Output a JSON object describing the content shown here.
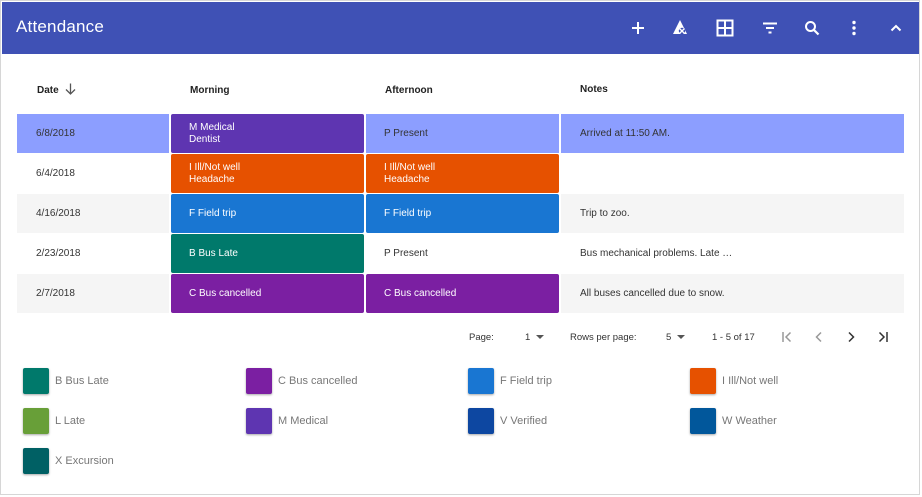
{
  "appbar": {
    "title": "Attendance",
    "background": "#3f51b5",
    "actions": [
      {
        "name": "add-icon"
      },
      {
        "name": "clear-formatting-icon"
      },
      {
        "name": "table-view-icon"
      },
      {
        "name": "filter-icon"
      },
      {
        "name": "search-icon"
      },
      {
        "name": "more-vert-icon"
      },
      {
        "name": "collapse-icon"
      }
    ]
  },
  "table": {
    "headers": {
      "date": "Date",
      "morning": "Morning",
      "afternoon": "Afternoon",
      "notes": "Notes"
    },
    "sort_direction": "descending",
    "rows": [
      {
        "date": "6/8/2018",
        "morning": {
          "line1": "M Medical",
          "line2": "Dentist",
          "color": "#5e35b1"
        },
        "afternoon": {
          "line1": "P Present",
          "line2": "",
          "color": ""
        },
        "notes": "Arrived at 11:50 AM.",
        "selected": true
      },
      {
        "date": "6/4/2018",
        "morning": {
          "line1": "I Ill/Not well",
          "line2": "Headache",
          "color": "#e65100"
        },
        "afternoon": {
          "line1": "I Ill/Not well",
          "line2": "Headache",
          "color": "#e65100"
        },
        "notes": "",
        "selected": false
      },
      {
        "date": "4/16/2018",
        "morning": {
          "line1": "F Field trip",
          "line2": "",
          "color": "#1976d2"
        },
        "afternoon": {
          "line1": "F Field trip",
          "line2": "",
          "color": "#1976d2"
        },
        "notes": "Trip to zoo.",
        "selected": false
      },
      {
        "date": "2/23/2018",
        "morning": {
          "line1": "B Bus Late",
          "line2": "",
          "color": "#00796b"
        },
        "afternoon": {
          "line1": "P Present",
          "line2": "",
          "color": ""
        },
        "notes": "Bus mechanical problems. Late …",
        "selected": false
      },
      {
        "date": "2/7/2018",
        "morning": {
          "line1": "C Bus cancelled",
          "line2": "",
          "color": "#7b1fa2"
        },
        "afternoon": {
          "line1": "C Bus cancelled",
          "line2": "",
          "color": "#7b1fa2"
        },
        "notes": "All buses cancelled due to snow.",
        "selected": false
      }
    ],
    "colors": {
      "selected_row": "#8c9eff",
      "zebra_row": "#f5f5f5",
      "plain_row": "#ffffff"
    }
  },
  "pager": {
    "page_label": "Page:",
    "page_value": "1",
    "rows_label": "Rows per page:",
    "rows_value": "5",
    "range": "1 - 5 of 17"
  },
  "legend": [
    {
      "label": "B Bus Late",
      "color": "#00796b"
    },
    {
      "label": "C Bus cancelled",
      "color": "#7b1fa2"
    },
    {
      "label": "F Field trip",
      "color": "#1976d2"
    },
    {
      "label": "I Ill/Not well",
      "color": "#e65100"
    },
    {
      "label": "L Late",
      "color": "#689f38"
    },
    {
      "label": "M Medical",
      "color": "#5e35b1"
    },
    {
      "label": "V Verified",
      "color": "#0d47a1"
    },
    {
      "label": "W Weather",
      "color": "#01579b"
    },
    {
      "label": "X Excursion",
      "color": "#006064"
    }
  ]
}
